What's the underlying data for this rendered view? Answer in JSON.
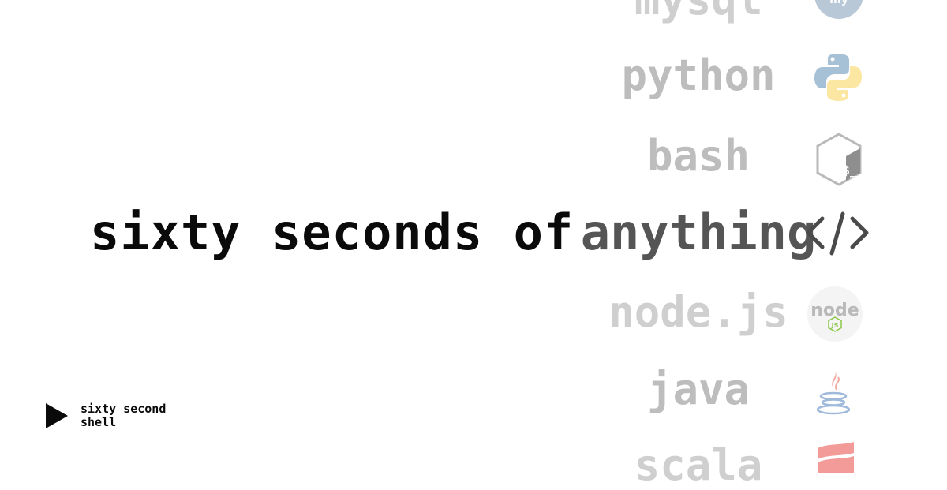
{
  "headline": "sixty seconds of",
  "languages": [
    {
      "label": "mysql",
      "icon": "mysql-icon"
    },
    {
      "label": "python",
      "icon": "python-icon"
    },
    {
      "label": "bash",
      "icon": "bash-icon"
    },
    {
      "label": "anything",
      "icon": "code-brackets-icon"
    },
    {
      "label": "node.js",
      "icon": "nodejs-icon"
    },
    {
      "label": "java",
      "icon": "java-icon"
    },
    {
      "label": "scala",
      "icon": "scala-icon"
    }
  ],
  "icon_texts": {
    "mysql": "my",
    "node": "node",
    "js": "JS",
    "bash": "$_"
  },
  "brand": {
    "name": "sixty second shell",
    "icon": "play-icon"
  },
  "colors": {
    "headline": "#0a0a0a",
    "active": "#555555",
    "inactive": "#bdbdbd",
    "python_blue": "#a6c1d6",
    "python_yellow": "#fbe7a1",
    "node_green": "#8cc84b",
    "java_blue": "#9fb9db",
    "java_red": "#f4a9a0",
    "scala_red": "#f29b99"
  }
}
